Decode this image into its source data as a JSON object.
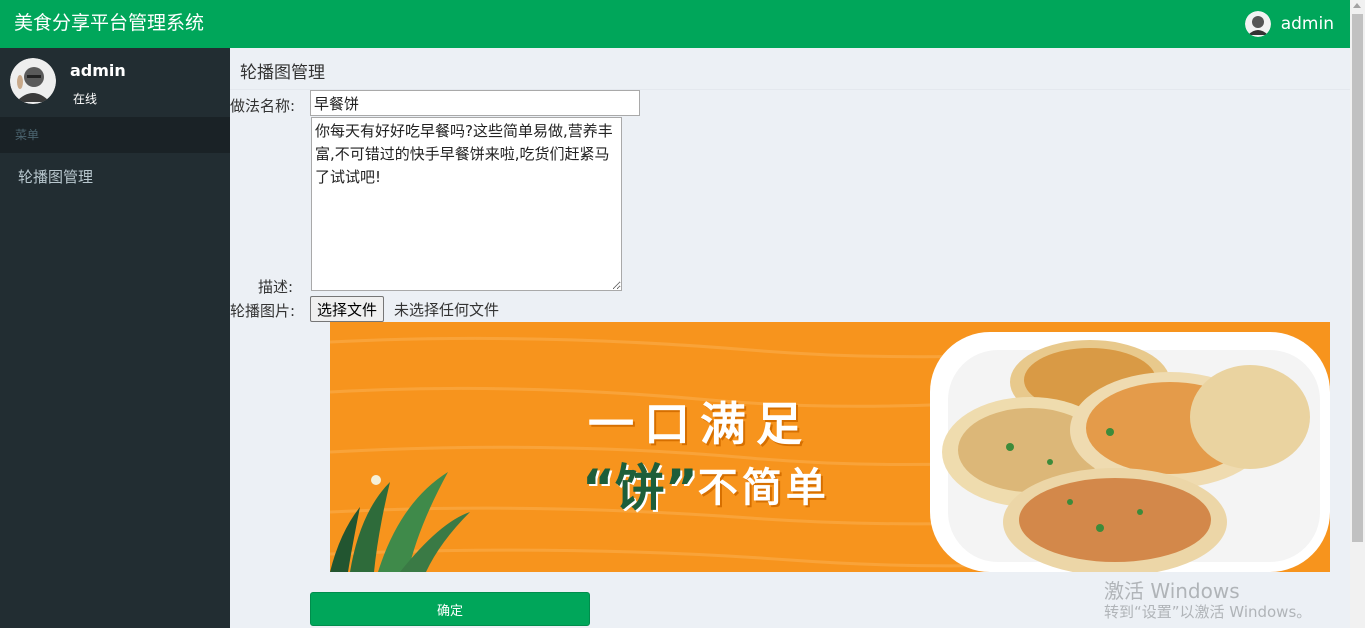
{
  "app": {
    "title": "美食分享平台管理系统"
  },
  "header": {
    "username": "admin"
  },
  "sidebar": {
    "username": "admin",
    "status": "在线",
    "menu_header": "菜单",
    "items": [
      {
        "label": "轮播图管理"
      }
    ]
  },
  "page": {
    "title": "轮播图管理"
  },
  "form": {
    "name_label": "做法名称:",
    "name_value": "早餐饼",
    "desc_label": "描述:",
    "desc_value": "你每天有好好吃早餐吗?这些简单易做,营养丰富,不可错过的快手早餐饼来啦,吃货们赶紧马了试试吧!",
    "image_label": "轮播图片:",
    "file_button": "选择文件",
    "file_status": "未选择任何文件",
    "banner": {
      "line1": "一口满足",
      "line2_a": "“饼”",
      "line2_b": "不简单"
    },
    "submit": "确定"
  },
  "watermark": {
    "line1": "激活 Windows",
    "line2": "转到“设置”以激活 Windows。"
  },
  "colors": {
    "primary": "#00a65a",
    "sidebar": "#222d32",
    "banner_orange": "#f7941d"
  }
}
